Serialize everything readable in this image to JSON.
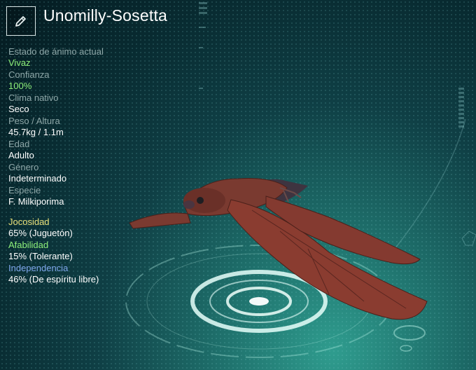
{
  "creature": {
    "name": "Unomilly-Sosetta"
  },
  "edit_button": {
    "icon": "pencil-icon"
  },
  "stats": [
    {
      "label": "Estado de ánimo actual",
      "value": "Vivaz"
    },
    {
      "label": "Confianza",
      "value": "100%"
    },
    {
      "label": "Clima nativo",
      "value": "Seco"
    },
    {
      "label": "Peso / Altura",
      "value": "45.7kg / 1.1m"
    },
    {
      "label": "Edad",
      "value": "Adulto"
    },
    {
      "label": "Género",
      "value": "Indeterminado"
    },
    {
      "label": "Especie",
      "value": "F. Milkiporima"
    }
  ],
  "personality": [
    {
      "label": "Jocosidad",
      "value": "65% (Juguetón)",
      "color": "#e9e07a"
    },
    {
      "label": "Afabilidad",
      "value": "15% (Tolerante)",
      "color": "#8ef07a"
    },
    {
      "label": "Independencia",
      "value": "46% (De espíritu libre)",
      "color": "#7fa7ec"
    }
  ],
  "colors": {
    "positive": "#8ef07a",
    "label": "#8ea7a8",
    "creature_body": "#7a3a30"
  }
}
